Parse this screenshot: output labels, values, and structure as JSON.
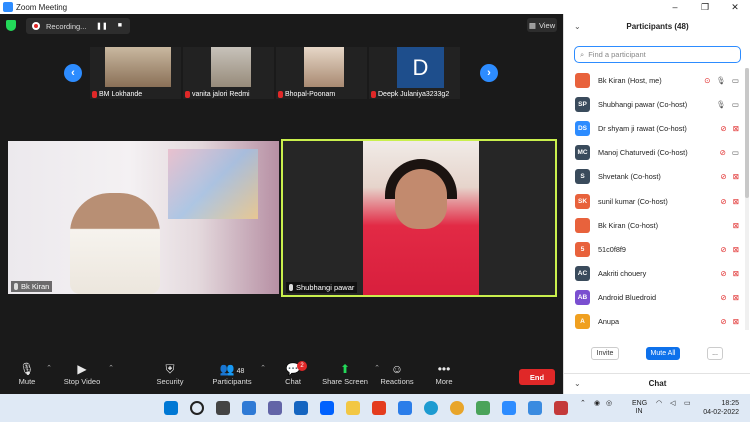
{
  "window": {
    "title": "Zoom Meeting",
    "controls": [
      "–",
      "❐",
      "✕"
    ]
  },
  "recording": {
    "label": "Recording...",
    "pause": "❚❚",
    "stop": "■"
  },
  "view_button": {
    "label": "View"
  },
  "thumbnails": [
    {
      "name": "BM Lokhande",
      "muted": true
    },
    {
      "name": "vanita jalori Redmi",
      "muted": true
    },
    {
      "name": "Bhopal-Poonam",
      "muted": true
    },
    {
      "name": "Deepk Julaniya3233g2",
      "muted": true,
      "initial": "D"
    }
  ],
  "gallery": {
    "left_tile": {
      "name": "Bk Kiran"
    },
    "right_tile": {
      "name": "Shubhangi pawar"
    }
  },
  "toolbar": {
    "mute": "Mute",
    "stop_video": "Stop Video",
    "security": "Security",
    "participants": "Participants",
    "participants_count": "48",
    "chat": "Chat",
    "chat_badge": "2",
    "share_screen": "Share Screen",
    "reactions": "Reactions",
    "more": "More",
    "end": "End"
  },
  "panel": {
    "title": "Participants (48)",
    "search_placeholder": "Find a participant",
    "participants": [
      {
        "initials": "",
        "name": "Bk Kiran (Host, me)",
        "color": "#e8623c",
        "mic": "on",
        "video": "on",
        "rec": true
      },
      {
        "initials": "SP",
        "name": "Shubhangi pawar (Co-host)",
        "color": "#3a4b5c",
        "mic": "on",
        "video": "on"
      },
      {
        "initials": "DS",
        "name": "Dr shyam ji rawat (Co-host)",
        "color": "#2d8cff",
        "mic": "off",
        "video": "off"
      },
      {
        "initials": "MC",
        "name": "Manoj Chaturvedi (Co-host)",
        "color": "#3a4b5c",
        "mic": "off",
        "video": "on"
      },
      {
        "initials": "S",
        "name": "Shvetank (Co-host)",
        "color": "#3a4b5c",
        "mic": "off",
        "video": "off"
      },
      {
        "initials": "SK",
        "name": "sunil kumar (Co-host)",
        "color": "#e8623c",
        "mic": "off",
        "video": "off"
      },
      {
        "initials": "",
        "name": "Bk Kiran (Co-host)",
        "color": "#e8623c",
        "mic": "",
        "video": "off"
      },
      {
        "initials": "5",
        "name": "51c0f8f9",
        "color": "#e8623c",
        "mic": "off",
        "video": "off"
      },
      {
        "initials": "AC",
        "name": "Aakriti chouery",
        "color": "#3a4b5c",
        "mic": "off",
        "video": "off"
      },
      {
        "initials": "AB",
        "name": "Android Bluedroid",
        "color": "#7a4fd0",
        "mic": "off",
        "video": "off"
      },
      {
        "initials": "A",
        "name": "Anupa",
        "color": "#f0a020",
        "mic": "off",
        "video": "off"
      }
    ],
    "invite": "Invite",
    "mute_all": "Mute All",
    "more": "...",
    "chat_label": "Chat"
  },
  "taskbar": {
    "lang": "ENG",
    "region": "IN",
    "time": "18:25",
    "date": "04-02-2022"
  }
}
